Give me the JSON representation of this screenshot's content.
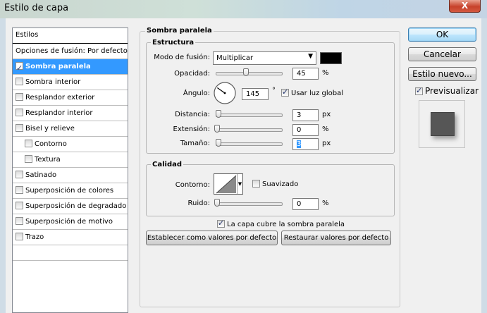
{
  "window": {
    "title": "Estilo de capa",
    "close_glyph": "X"
  },
  "styles": {
    "header": "Estilos",
    "items": [
      {
        "label": "Opciones de fusión: Por defecto",
        "checkbox": false,
        "checked": false,
        "selected": false,
        "sub": false
      },
      {
        "label": "Sombra paralela",
        "checkbox": true,
        "checked": true,
        "selected": true,
        "sub": false
      },
      {
        "label": "Sombra interior",
        "checkbox": true,
        "checked": false,
        "selected": false,
        "sub": false
      },
      {
        "label": "Resplandor exterior",
        "checkbox": true,
        "checked": false,
        "selected": false,
        "sub": false
      },
      {
        "label": "Resplandor interior",
        "checkbox": true,
        "checked": false,
        "selected": false,
        "sub": false
      },
      {
        "label": "Bisel y relieve",
        "checkbox": true,
        "checked": false,
        "selected": false,
        "sub": false
      },
      {
        "label": "Contorno",
        "checkbox": true,
        "checked": false,
        "selected": false,
        "sub": true
      },
      {
        "label": "Textura",
        "checkbox": true,
        "checked": false,
        "selected": false,
        "sub": true
      },
      {
        "label": "Satinado",
        "checkbox": true,
        "checked": false,
        "selected": false,
        "sub": false
      },
      {
        "label": "Superposición de colores",
        "checkbox": true,
        "checked": false,
        "selected": false,
        "sub": false
      },
      {
        "label": "Superposición de degradado",
        "checkbox": true,
        "checked": false,
        "selected": false,
        "sub": false
      },
      {
        "label": "Superposición de motivo",
        "checkbox": true,
        "checked": false,
        "selected": false,
        "sub": false
      },
      {
        "label": "Trazo",
        "checkbox": true,
        "checked": false,
        "selected": false,
        "sub": false
      }
    ]
  },
  "drop_shadow": {
    "title": "Sombra paralela",
    "structure": {
      "title": "Estructura",
      "blend_mode_label": "Modo de fusión:",
      "blend_mode_value": "Multiplicar",
      "shadow_color": "#000000",
      "opacity_label": "Opacidad:",
      "opacity_value": "45",
      "opacity_unit": "%",
      "opacity_level": 0.45,
      "angle_label": "Ángulo:",
      "angle_value": "145",
      "angle_unit": "°",
      "global_light_label": "Usar luz global",
      "global_light_checked": true,
      "distance_label": "Distancia:",
      "distance_value": "3",
      "distance_unit": "px",
      "spread_label": "Extensión:",
      "spread_value": "0",
      "spread_unit": "%",
      "size_label": "Tamaño:",
      "size_value": "3",
      "size_unit": "px"
    },
    "quality": {
      "title": "Calidad",
      "contour_label": "Contorno:",
      "antialias_label": "Suavizado",
      "antialias_checked": false,
      "noise_label": "Ruido:",
      "noise_value": "0",
      "noise_unit": "%"
    },
    "knockout_label": "La capa cubre la sombra paralela",
    "knockout_checked": true,
    "make_default_label": "Establecer como valores por defecto",
    "reset_default_label": "Restaurar valores por defecto"
  },
  "actions": {
    "ok_label": "OK",
    "cancel_label": "Cancelar",
    "new_style_label": "Estilo nuevo...",
    "preview_label": "Previsualizar",
    "preview_checked": true
  }
}
